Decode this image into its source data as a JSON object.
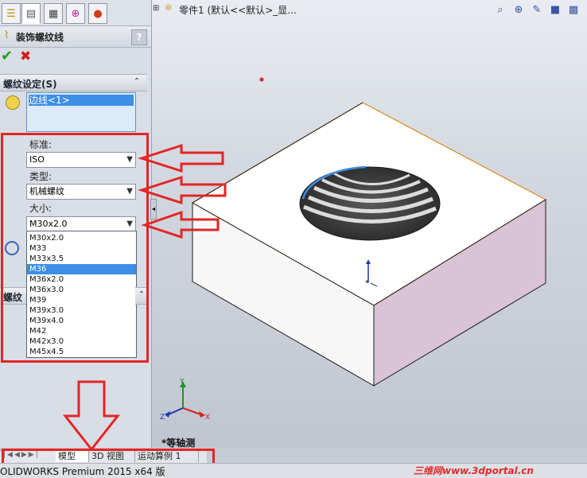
{
  "panel": {
    "title": "装饰螺纹线",
    "help": "?",
    "ok_icon": "checkmark-icon",
    "cancel_icon": "x-icon",
    "section1": "螺纹设定(S)",
    "edge_item": "边线<1>",
    "standard_label": "标准:",
    "standard_value": "ISO",
    "type_label": "类型:",
    "type_value": "机械螺纹",
    "size_label": "大小:",
    "size_value": "M30x2.0",
    "size_options": [
      "M30x2.0",
      "M33",
      "M33x3.5",
      "M36",
      "M36x2.0",
      "M36x3.0",
      "M39",
      "M39x3.0",
      "M39x4.0",
      "M42",
      "M42x3.0",
      "M45x4.5"
    ],
    "selected_option": "M36",
    "section2": "螺纹"
  },
  "viewport": {
    "tree_text": "零件1  (默认<<默认>_显...",
    "view_label": "*等轴测",
    "triad": {
      "x": "X",
      "y": "Y",
      "z": "Z"
    }
  },
  "bottom_tabs": [
    "模型",
    "3D 视图",
    "运动算例 1"
  ],
  "status": "OLIDWORKS Premium 2015 x64 版",
  "watermark": "三维网www.3dportal.cn",
  "colors": {
    "highlight": "#e32525",
    "selection": "#3d8ee6",
    "edge": "#d98a1f"
  }
}
